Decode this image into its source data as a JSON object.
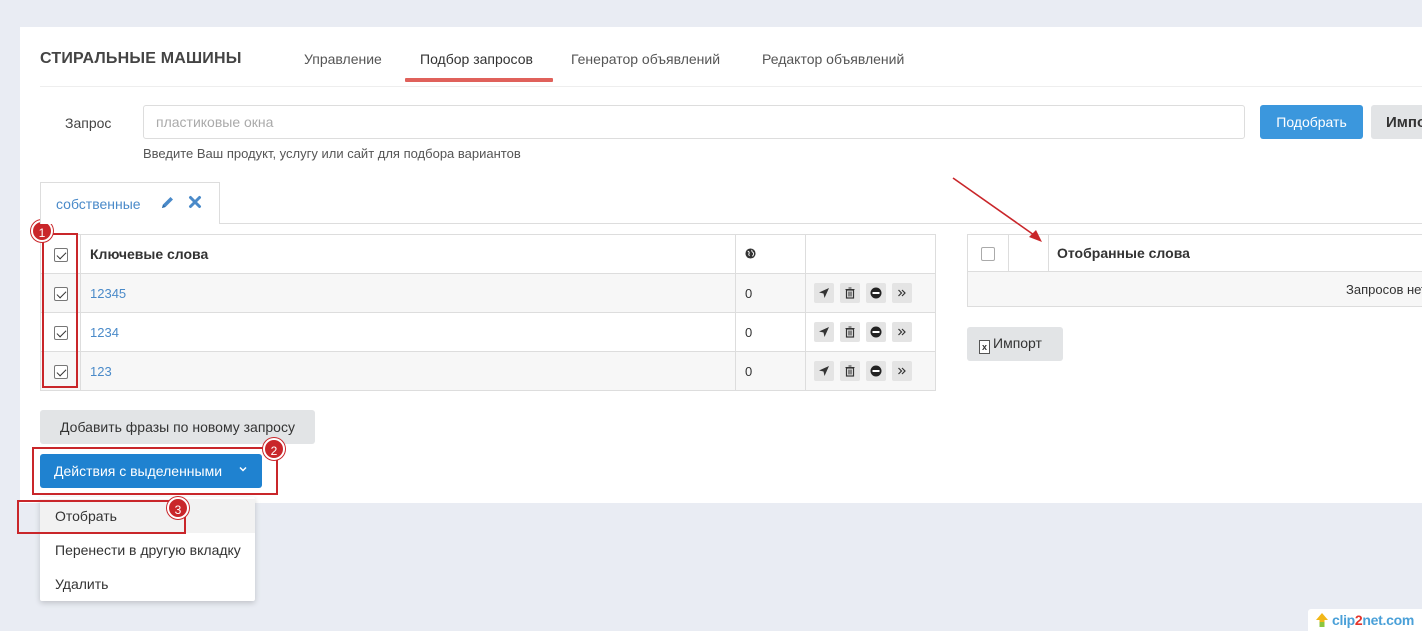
{
  "header": {
    "title": "СТИРАЛЬНЫЕ МАШИНЫ",
    "tabs": [
      {
        "label": "Управление"
      },
      {
        "label": "Подбор запросов"
      },
      {
        "label": "Генератор объявлений"
      },
      {
        "label": "Редактор объявлений"
      }
    ],
    "active_tab": "Подбор запросов"
  },
  "query": {
    "label": "Запрос",
    "placeholder": "пластиковые окна",
    "hint": "Введите Ваш продукт, услугу или сайт для подбора вариантов",
    "submit_label": "Подобрать",
    "import_label": "Импорт"
  },
  "subtabs": [
    {
      "label": "собственные"
    }
  ],
  "keywords_table": {
    "header": "Ключевые слова",
    "rows": [
      {
        "keyword": "12345",
        "count": "0",
        "checked": true
      },
      {
        "keyword": "1234",
        "count": "0",
        "checked": true
      },
      {
        "keyword": "123",
        "count": "0",
        "checked": true
      }
    ]
  },
  "selected_table": {
    "header": "Отобранные слова",
    "empty_text": "Запросов нет"
  },
  "import_button": "Импорт",
  "add_phrases_button": "Добавить фразы по новому запросу",
  "actions_button": "Действия с выделенными",
  "actions_menu": [
    {
      "label": "Отобрать"
    },
    {
      "label": "Перенести в другую вкладку"
    },
    {
      "label": "Удалить"
    }
  ],
  "annotations": [
    "1",
    "2",
    "3"
  ],
  "watermark": {
    "text_a": "clip",
    "text_b": "2",
    "text_c": "net.com"
  },
  "colors": {
    "accent": "#3b97dd",
    "actions_button": "#1f82d0",
    "active_tab_underline": "#e0615b",
    "link": "#4a8ac9",
    "annotation_red": "#c9262a"
  }
}
